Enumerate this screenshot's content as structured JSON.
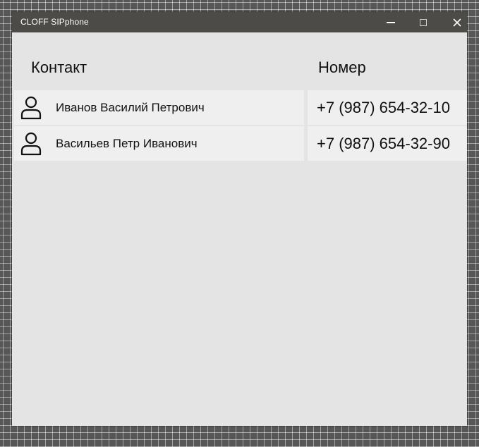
{
  "window": {
    "title": "CLOFF SIPphone"
  },
  "table": {
    "headers": {
      "contact": "Контакт",
      "number": "Номер"
    },
    "rows": [
      {
        "icon": "person-icon",
        "name": "Иванов Василий Петрович",
        "phone": "+7 (987) 654-32-10"
      },
      {
        "icon": "person-icon",
        "name": "Васильев Петр Иванович",
        "phone": "+7 (987) 654-32-90"
      }
    ]
  },
  "colors": {
    "titlebar": "#4d4b48",
    "window_bg": "#e4e4e4",
    "row_bg": "#efefef",
    "desktop": "#575757"
  }
}
